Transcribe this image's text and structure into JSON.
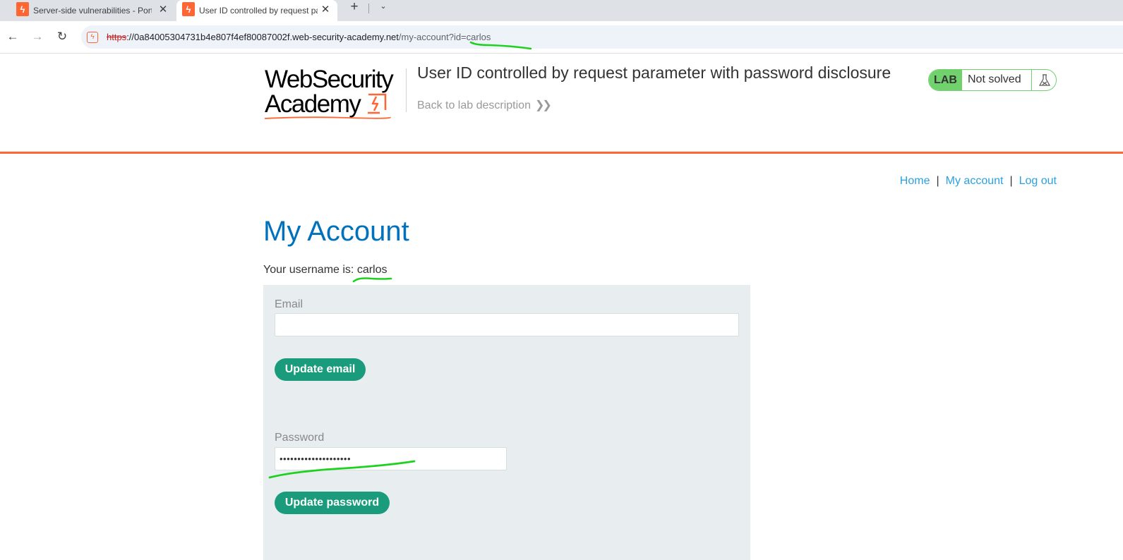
{
  "browser": {
    "tabs": [
      {
        "title": "Server-side vulnerabilities - Portswigger",
        "active": false
      },
      {
        "title": "User ID controlled by request parameter with password disclosure",
        "active": true
      }
    ],
    "new_tab_icon": "plus-icon",
    "tab_list_icon": "chevron-down-icon",
    "url": {
      "scheme": "https",
      "host": "://0a84005304731b4e807f4ef80087002f.web-security-academy.net",
      "path": "/my-account?id=carlos"
    }
  },
  "header": {
    "logo_line1": "WebSecurity",
    "logo_line2": "Academy",
    "lab_title": "User ID controlled by request parameter with password disclosure",
    "back_link": "Back to lab description",
    "lab_badge": "LAB",
    "lab_status": "Not solved",
    "brand_color": "#ff6633"
  },
  "nav": {
    "home": "Home",
    "sep1": "|",
    "my_account": "My account",
    "sep2": "|",
    "log_out": "Log out"
  },
  "main": {
    "title": "My Account",
    "username_prefix": "Your username is: ",
    "username": "carlos",
    "email_label": "Email",
    "email_value": "",
    "update_email_button": "Update email",
    "password_label": "Password",
    "password_value": "••••••••••••••••••••",
    "update_password_button": "Update password"
  },
  "colors": {
    "accent_blue": "#0071bc",
    "link_blue": "#29a1e3",
    "button_green": "#1a9c7c",
    "lab_green": "#70d16d",
    "annotation_green": "#1fd11f"
  }
}
